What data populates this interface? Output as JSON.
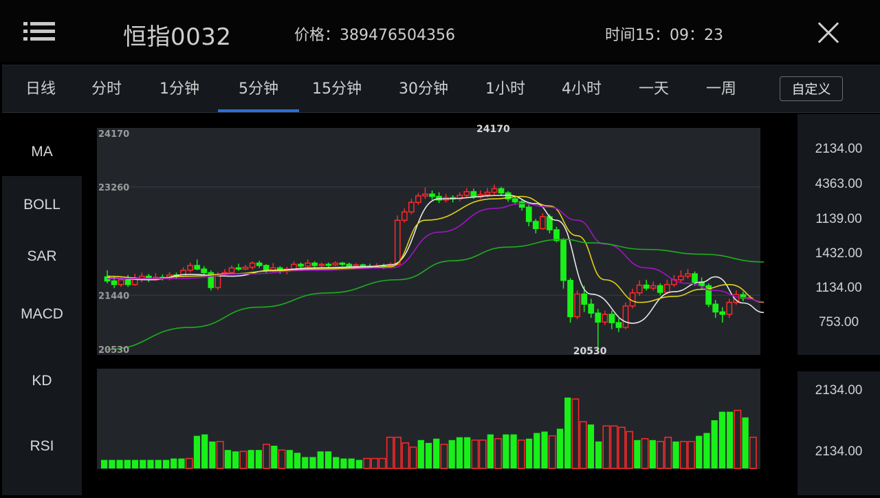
{
  "header": {
    "title": "恒指0032",
    "price": "价格：389476504356",
    "time": "时间15：09：23"
  },
  "tabs": [
    {
      "label": "日线"
    },
    {
      "label": "分时"
    },
    {
      "label": "1分钟"
    },
    {
      "label": "5分钟",
      "active": true
    },
    {
      "label": "15分钟"
    },
    {
      "label": "30分钟"
    },
    {
      "label": "1小时"
    },
    {
      "label": "4小时"
    },
    {
      "label": "一天"
    },
    {
      "label": "一周"
    }
  ],
  "custom_label": "自定义",
  "indicators": [
    "MA",
    "BOLL",
    "SAR",
    "MACD",
    "KD",
    "RSI"
  ],
  "price_axis": [
    "2134.00",
    "4363.00",
    "1139.00",
    "1432.00",
    "1134.00",
    "753.00"
  ],
  "volume_axis": [
    "2134.00",
    "2134.00"
  ],
  "colors": {
    "up": "#ff2a2a",
    "down": "#19f019",
    "ma_white": "#e8e8e8",
    "ma_yellow": "#e3d11a",
    "ma_purple": "#a313c4",
    "ma_green": "#1fae1f",
    "accent": "#2c6fd6"
  },
  "chart_data": {
    "type": "candlestick",
    "grid_labels": [
      "24170",
      "23260",
      "21440",
      "20530"
    ],
    "high_marker": "24170",
    "low_marker": "20530",
    "ylim": [
      20530,
      24170
    ],
    "candles": [
      [
        21750,
        21680,
        21860,
        21640
      ],
      [
        21680,
        21620,
        21760,
        21560
      ],
      [
        21620,
        21700,
        21760,
        21580
      ],
      [
        21700,
        21620,
        21780,
        21580
      ],
      [
        21620,
        21720,
        21800,
        21600
      ],
      [
        21720,
        21760,
        21820,
        21660
      ],
      [
        21760,
        21700,
        21800,
        21660
      ],
      [
        21700,
        21740,
        21810,
        21680
      ],
      [
        21740,
        21720,
        21790,
        21690
      ],
      [
        21720,
        21780,
        21830,
        21690
      ],
      [
        21780,
        21760,
        21820,
        21720
      ],
      [
        21760,
        21860,
        21910,
        21740
      ],
      [
        21860,
        21940,
        21990,
        21820
      ],
      [
        21940,
        21880,
        22040,
        21860
      ],
      [
        21880,
        21820,
        21930,
        21790
      ],
      [
        21820,
        21570,
        21860,
        21520
      ],
      [
        21570,
        21790,
        21830,
        21530
      ],
      [
        21790,
        21820,
        21880,
        21760
      ],
      [
        21820,
        21900,
        21940,
        21790
      ],
      [
        21900,
        21880,
        21970,
        21850
      ],
      [
        21880,
        21910,
        21950,
        21860
      ],
      [
        21910,
        21980,
        22010,
        21870
      ],
      [
        21980,
        21940,
        22020,
        21900
      ],
      [
        21940,
        21860,
        21960,
        21820
      ],
      [
        21860,
        21900,
        21980,
        21830
      ],
      [
        21900,
        21860,
        21930,
        21800
      ],
      [
        21860,
        21880,
        21920,
        21790
      ],
      [
        21880,
        21960,
        22010,
        21860
      ],
      [
        21960,
        21930,
        21990,
        21900
      ],
      [
        21930,
        21980,
        22040,
        21900
      ],
      [
        21980,
        21940,
        22010,
        21910
      ],
      [
        21940,
        21960,
        21990,
        21910
      ],
      [
        21960,
        21950,
        21990,
        21910
      ],
      [
        21950,
        21980,
        22010,
        21930
      ],
      [
        21980,
        21960,
        22000,
        21930
      ],
      [
        21960,
        21930,
        21990,
        21900
      ],
      [
        21930,
        21950,
        21980,
        21900
      ],
      [
        21950,
        21930,
        21970,
        21900
      ],
      [
        21930,
        21920,
        21970,
        21900
      ],
      [
        21920,
        21940,
        21980,
        21890
      ],
      [
        21940,
        21930,
        21970,
        21880
      ],
      [
        21930,
        21960,
        21990,
        21900
      ],
      [
        21960,
        22700,
        22780,
        21940
      ],
      [
        22700,
        22840,
        22900,
        22660
      ],
      [
        22840,
        23000,
        23060,
        22800
      ],
      [
        23000,
        23110,
        23160,
        22960
      ],
      [
        23110,
        23140,
        23250,
        23060
      ],
      [
        23140,
        23100,
        23200,
        23040
      ],
      [
        23100,
        23040,
        23170,
        22990
      ],
      [
        23040,
        23080,
        23140,
        23000
      ],
      [
        23080,
        23060,
        23120,
        23000
      ],
      [
        23060,
        23120,
        23170,
        23020
      ],
      [
        23120,
        23180,
        23240,
        23080
      ],
      [
        23180,
        23090,
        23230,
        23060
      ],
      [
        23090,
        23130,
        23200,
        23060
      ],
      [
        23130,
        23170,
        23240,
        23090
      ],
      [
        23170,
        23230,
        23300,
        23130
      ],
      [
        23230,
        23160,
        23260,
        23110
      ],
      [
        23160,
        23060,
        23190,
        23010
      ],
      [
        23060,
        23010,
        23100,
        22960
      ],
      [
        23010,
        22920,
        23060,
        22860
      ],
      [
        22920,
        22680,
        22960,
        22600
      ],
      [
        22680,
        22560,
        22720,
        22480
      ],
      [
        22560,
        22760,
        22820,
        22540
      ],
      [
        22760,
        22540,
        22800,
        22480
      ],
      [
        22540,
        22360,
        22590,
        22330
      ],
      [
        22360,
        21690,
        22400,
        21550
      ],
      [
        21690,
        21080,
        21730,
        20980
      ],
      [
        21080,
        21460,
        21520,
        21040
      ],
      [
        21460,
        21290,
        21600,
        21160
      ],
      [
        21290,
        21140,
        21380,
        21060
      ],
      [
        21140,
        20990,
        21210,
        20530
      ],
      [
        20990,
        21120,
        21180,
        20940
      ],
      [
        21120,
        20980,
        21180,
        20870
      ],
      [
        20980,
        20900,
        21050,
        20820
      ],
      [
        20900,
        21260,
        21320,
        20870
      ],
      [
        21260,
        21480,
        21550,
        21220
      ],
      [
        21480,
        21610,
        21690,
        21430
      ],
      [
        21610,
        21560,
        21700,
        21520
      ],
      [
        21560,
        21600,
        21670,
        21520
      ],
      [
        21600,
        21490,
        21640,
        21440
      ],
      [
        21490,
        21620,
        21700,
        21460
      ],
      [
        21620,
        21700,
        21780,
        21580
      ],
      [
        21700,
        21760,
        21860,
        21650
      ],
      [
        21760,
        21800,
        21880,
        21720
      ],
      [
        21800,
        21660,
        21840,
        21600
      ],
      [
        21660,
        21600,
        21740,
        21540
      ],
      [
        21600,
        21290,
        21640,
        21240
      ],
      [
        21290,
        21160,
        21360,
        21060
      ],
      [
        21160,
        21120,
        21240,
        20980
      ],
      [
        21120,
        21320,
        21380,
        21060
      ],
      [
        21320,
        21450,
        21520,
        21280
      ],
      [
        21450,
        21390,
        21500,
        21340
      ],
      [
        21390,
        21400,
        21440,
        21370
      ]
    ],
    "volume": [
      [
        12,
        1
      ],
      [
        12,
        1
      ],
      [
        12,
        1
      ],
      [
        12,
        1
      ],
      [
        12,
        1
      ],
      [
        12,
        1
      ],
      [
        12,
        1
      ],
      [
        12,
        1
      ],
      [
        12,
        1
      ],
      [
        14,
        1
      ],
      [
        14,
        1
      ],
      [
        14,
        0
      ],
      [
        46,
        1
      ],
      [
        48,
        1
      ],
      [
        38,
        1
      ],
      [
        38,
        0
      ],
      [
        26,
        1
      ],
      [
        24,
        1
      ],
      [
        24,
        0
      ],
      [
        26,
        1
      ],
      [
        26,
        1
      ],
      [
        34,
        0
      ],
      [
        32,
        1
      ],
      [
        26,
        0
      ],
      [
        26,
        1
      ],
      [
        22,
        1
      ],
      [
        16,
        1
      ],
      [
        16,
        1
      ],
      [
        24,
        1
      ],
      [
        24,
        1
      ],
      [
        16,
        1
      ],
      [
        14,
        1
      ],
      [
        14,
        1
      ],
      [
        12,
        1
      ],
      [
        14,
        0
      ],
      [
        14,
        0
      ],
      [
        14,
        0
      ],
      [
        44,
        0
      ],
      [
        44,
        0
      ],
      [
        36,
        0
      ],
      [
        30,
        0
      ],
      [
        40,
        1
      ],
      [
        36,
        1
      ],
      [
        42,
        1
      ],
      [
        34,
        0
      ],
      [
        40,
        1
      ],
      [
        44,
        1
      ],
      [
        44,
        1
      ],
      [
        40,
        0
      ],
      [
        40,
        0
      ],
      [
        48,
        1
      ],
      [
        42,
        0
      ],
      [
        48,
        1
      ],
      [
        48,
        1
      ],
      [
        40,
        0
      ],
      [
        42,
        1
      ],
      [
        50,
        1
      ],
      [
        52,
        1
      ],
      [
        46,
        0
      ],
      [
        56,
        1
      ],
      [
        100,
        1
      ],
      [
        98,
        0
      ],
      [
        66,
        0
      ],
      [
        62,
        1
      ],
      [
        38,
        1
      ],
      [
        60,
        0
      ],
      [
        60,
        0
      ],
      [
        58,
        0
      ],
      [
        52,
        0
      ],
      [
        40,
        1
      ],
      [
        42,
        0
      ],
      [
        40,
        1
      ],
      [
        38,
        0
      ],
      [
        44,
        0
      ],
      [
        38,
        1
      ],
      [
        38,
        0
      ],
      [
        38,
        0
      ],
      [
        46,
        1
      ],
      [
        50,
        1
      ],
      [
        68,
        1
      ],
      [
        80,
        1
      ],
      [
        80,
        1
      ],
      [
        82,
        0
      ],
      [
        72,
        1
      ],
      [
        44,
        0
      ]
    ],
    "ma_lines": {
      "white": [
        [
          0,
          21730
        ],
        [
          6,
          21700
        ],
        [
          12,
          21790
        ],
        [
          18,
          21760
        ],
        [
          24,
          21860
        ],
        [
          30,
          21900
        ],
        [
          38,
          21920
        ],
        [
          41,
          21950
        ],
        [
          48,
          23060
        ],
        [
          58,
          23120
        ],
        [
          62,
          22980
        ],
        [
          65,
          22700
        ],
        [
          70,
          21460
        ],
        [
          76,
          20970
        ],
        [
          82,
          21500
        ],
        [
          86,
          21660
        ],
        [
          88,
          21750
        ],
        [
          92,
          21310
        ],
        [
          95,
          21150
        ]
      ],
      "yellow": [
        [
          0,
          21760
        ],
        [
          6,
          21720
        ],
        [
          12,
          21760
        ],
        [
          18,
          21800
        ],
        [
          24,
          21850
        ],
        [
          30,
          21880
        ],
        [
          38,
          21900
        ],
        [
          41,
          21920
        ],
        [
          46,
          22700
        ],
        [
          56,
          23060
        ],
        [
          60,
          23100
        ],
        [
          64,
          22940
        ],
        [
          68,
          22440
        ],
        [
          72,
          21700
        ],
        [
          77,
          21320
        ],
        [
          82,
          21420
        ],
        [
          86,
          21540
        ],
        [
          90,
          21620
        ],
        [
          95,
          21320
        ]
      ],
      "purple": [
        [
          0,
          21720
        ],
        [
          10,
          21720
        ],
        [
          20,
          21800
        ],
        [
          30,
          21860
        ],
        [
          41,
          21900
        ],
        [
          48,
          22500
        ],
        [
          56,
          22900
        ],
        [
          60,
          22980
        ],
        [
          64,
          22920
        ],
        [
          68,
          22700
        ],
        [
          72,
          22300
        ],
        [
          78,
          21900
        ],
        [
          84,
          21640
        ],
        [
          88,
          21520
        ],
        [
          92,
          21400
        ],
        [
          95,
          21330
        ]
      ],
      "green": [
        [
          0,
          20530
        ],
        [
          12,
          20900
        ],
        [
          22,
          21240
        ],
        [
          32,
          21480
        ],
        [
          42,
          21700
        ],
        [
          50,
          22020
        ],
        [
          58,
          22250
        ],
        [
          66,
          22380
        ],
        [
          70,
          22320
        ],
        [
          78,
          22210
        ],
        [
          86,
          22130
        ],
        [
          95,
          22000
        ]
      ]
    }
  }
}
